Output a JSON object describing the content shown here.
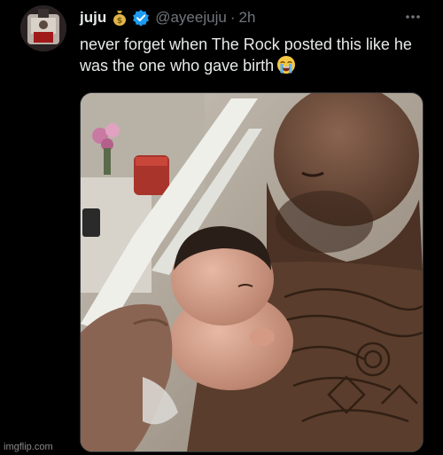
{
  "tweet": {
    "display_name": "juju",
    "name_emoji": "money-bag-icon",
    "verified": true,
    "handle": "@ayeejuju",
    "separator": "·",
    "time": "2h",
    "text": "never forget when The Rock posted this like he was the one who gave birth",
    "text_emoji": "loudly-crying-face-icon"
  },
  "media": {
    "description": "photo-of-man-holding-newborn-in-hospital"
  },
  "watermark": "imgflip.com",
  "colors": {
    "background": "#000000",
    "text_primary": "#e7e9ea",
    "text_secondary": "#71767b",
    "verified_blue": "#1d9bf0"
  }
}
